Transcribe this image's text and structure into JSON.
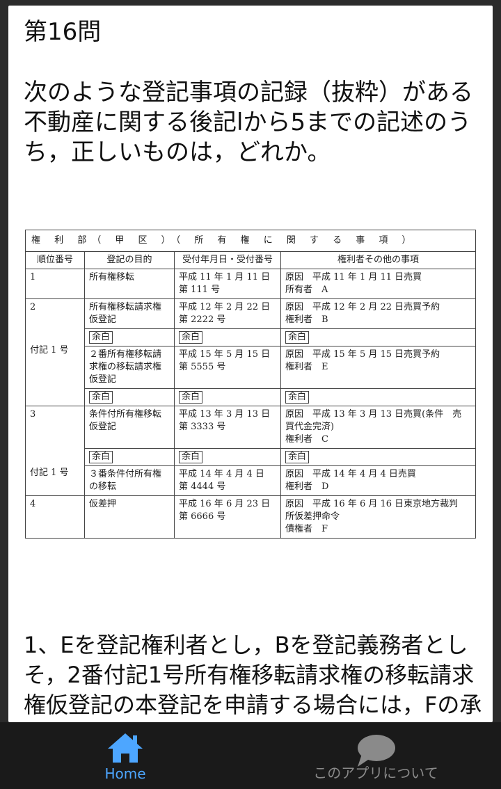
{
  "question": {
    "number_label": "第16問",
    "text": "次のような登記事項の記録（抜粋）がある不動産に関する後記lから5までの記述のうち，正しいものは，どれか。"
  },
  "register": {
    "title": "権 利 部（ 甲 区 ）（ 所 有 権 に 関 す る 事 項 ）",
    "headers": [
      "順位番号",
      "登記の目的",
      "受付年月日・受付番号",
      "権利者その他の事項"
    ],
    "margin_label": "余白",
    "rows": [
      {
        "no": "1",
        "purpose": "所有権移転",
        "received": "平成 11 年 1 月 11 日\n第 111 号",
        "details": "原因　平成 11 年 1 月 11 日売買\n所有者　A"
      },
      {
        "no": "2",
        "purpose": "所有権移転請求権\n仮登記",
        "received": "平成 12 年 2 月 22 日\n第 2222 号",
        "details": "原因　平成 12 年 2 月 22 日売買予約\n権利者　B"
      },
      {
        "no": "付記 1 号",
        "purpose": "２番所有権移転請\n求権の移転請求権\n仮登記",
        "received": "平成 15 年 5 月 15 日\n第 5555 号",
        "details": "原因　平成 15 年 5 月 15 日売買予約\n権利者　E"
      },
      {
        "no": "3",
        "purpose": "条件付所有権移転\n仮登記",
        "received": "平成 13 年 3 月 13 日\n第 3333 号",
        "details": "原因　平成 13 年 3 月 13 日売買(条件　売\n買代金完済)\n権利者　C"
      },
      {
        "no": "付記 1 号",
        "purpose": "３番条件付所有権\nの移転",
        "received": "平成 14 年 4 月 4 日\n第 4444 号",
        "details": "原因　平成 14 年 4 月 4 日売買\n権利者　D"
      },
      {
        "no": "4",
        "purpose": "仮差押",
        "received": "平成 16 年 6 月 23 日\n第 6666 号",
        "details": "原因　平成 16 年 6 月 16 日東京地方裁判\n所仮差押命令\n債権者　F"
      }
    ]
  },
  "choice_1": "1、Eを登記権利者とし，Bを登記義務者としそ，2番付記1号所有権移転請求権の移転請求権仮登記の本登記を申請する場合には，Fの承諾を証する情報の提供を要する。",
  "nav": {
    "home_label": "Home",
    "about_label": "このアプリについて",
    "active_color": "#4da6ff",
    "inactive_color": "#8a8a8a"
  }
}
